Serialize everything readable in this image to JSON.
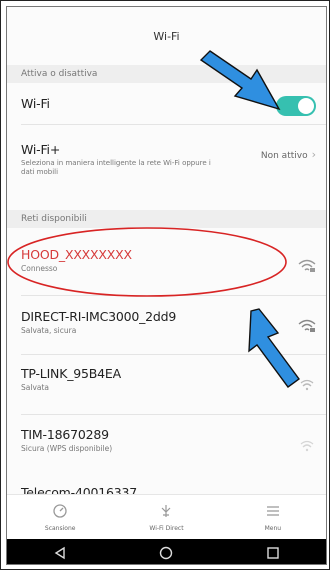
{
  "header": {
    "title": "Wi-Fi"
  },
  "section_toggle": {
    "label": "Attiva o disattiva",
    "wifi_label": "Wi-Fi",
    "wifi_enabled": true,
    "wifi_plus": {
      "label": "Wi-Fi+",
      "description": "Seleziona in maniera intelligente la rete Wi-Fi oppure i dati mobili",
      "status": "Non attivo"
    }
  },
  "section_networks": {
    "label": "Reti disponibili",
    "networks": [
      {
        "name": "HOOD_XXXXXXXX",
        "status": "Connesso"
      },
      {
        "name": "DIRECT-RI-IMC3000_2dd9",
        "status": "Salvata, sicura"
      },
      {
        "name": "TP-LINK_95B4EA",
        "status": "Salvata"
      },
      {
        "name": "TIM-18670289",
        "status": "Sicura (WPS disponibile)"
      }
    ],
    "partial_next": "Telecom-40016337"
  },
  "bottom_bar": {
    "items": [
      {
        "label": "Scansione",
        "icon": "scan-icon"
      },
      {
        "label": "Wi-Fi Direct",
        "icon": "wifi-direct-icon"
      },
      {
        "label": "Menu",
        "icon": "menu-icon"
      }
    ]
  },
  "nav_bar": {
    "icons": [
      "back-icon",
      "home-icon",
      "recents-icon"
    ]
  },
  "colors": {
    "accent": "#36c0b0",
    "connected_text": "#d63a3a",
    "annotation_arrow": "#2f8fe0",
    "annotation_circle": "#d82424"
  }
}
